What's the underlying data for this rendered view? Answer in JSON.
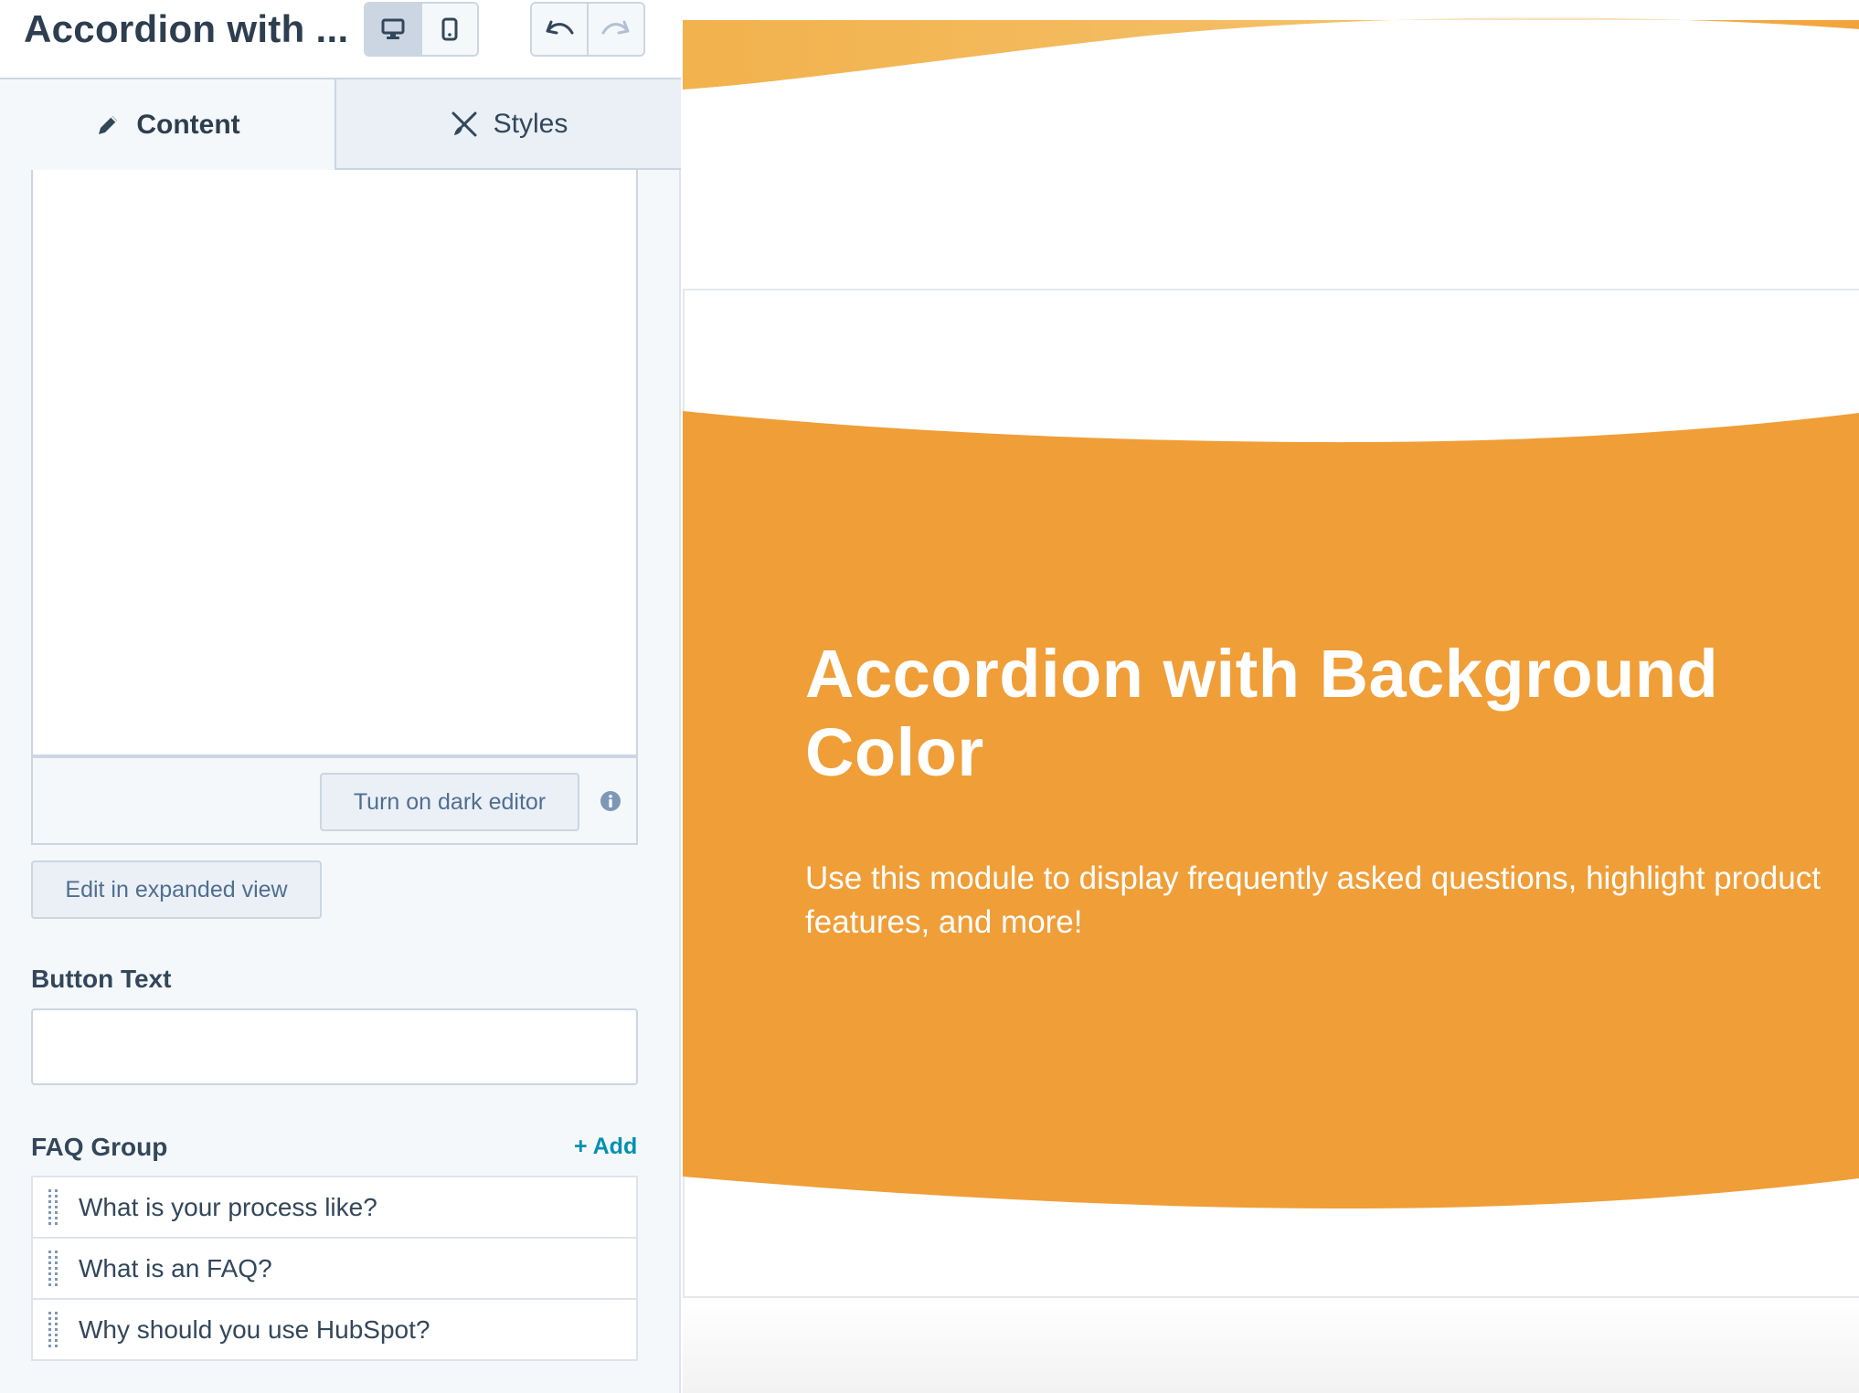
{
  "header": {
    "title": "Accordion with ...",
    "view_buttons": [
      {
        "name": "desktop-view",
        "icon": "desktop-icon",
        "active": true
      },
      {
        "name": "mobile-view",
        "icon": "mobile-icon",
        "active": false
      }
    ],
    "history_buttons": [
      {
        "name": "undo",
        "icon": "undo-icon"
      },
      {
        "name": "redo",
        "icon": "redo-icon"
      }
    ]
  },
  "tabs": [
    {
      "label": "Content",
      "icon": "pencil-icon",
      "active": true
    },
    {
      "label": "Styles",
      "icon": "brush-icon",
      "active": false
    }
  ],
  "editor": {
    "dark_editor_label": "Turn on dark editor",
    "info_icon": "info-icon",
    "expanded_view_label": "Edit in expanded view"
  },
  "button_text": {
    "label": "Button Text",
    "value": ""
  },
  "faq_group": {
    "label": "FAQ Group",
    "add_label": "+ Add",
    "items": [
      "What is your process like?",
      "What is an FAQ?",
      "Why should you use HubSpot?"
    ]
  },
  "preview": {
    "title": "Accordion with Background Color",
    "description": "Use this module to display frequently asked questions, highlight product features, and more!",
    "colors": {
      "accent": "#f09e38",
      "accent_light": "#f2b24c",
      "text": "#ffffff"
    }
  }
}
